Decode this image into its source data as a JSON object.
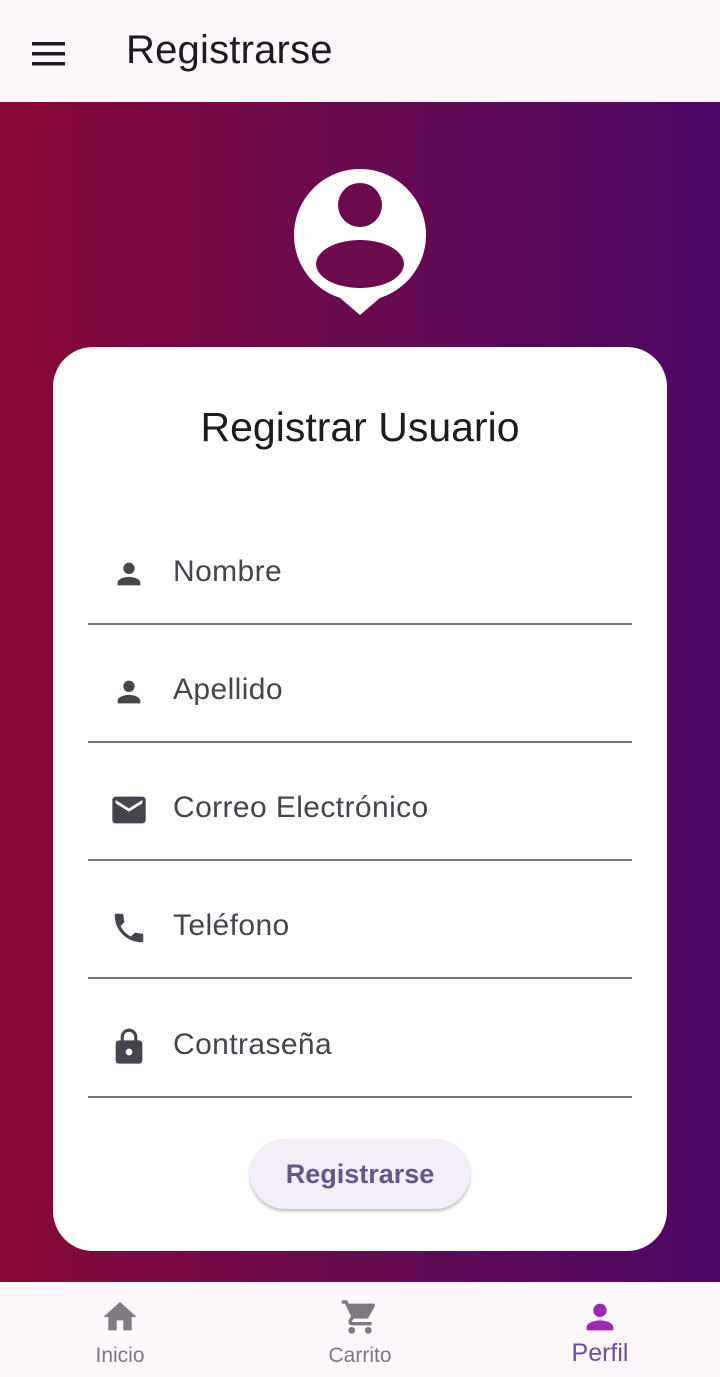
{
  "app_bar": {
    "title": "Registrarse",
    "menu_icon": "menu-icon"
  },
  "colors": {
    "gradient_start": "#8a0735",
    "gradient_end": "#4c0766",
    "accent": "#65558f",
    "active_nav": "#9c27b0"
  },
  "avatar": {
    "icon": "account-circle-icon"
  },
  "form": {
    "title": "Registrar Usuario",
    "fields": [
      {
        "icon": "person-icon",
        "placeholder": "Nombre"
      },
      {
        "icon": "person-icon",
        "placeholder": "Apellido"
      },
      {
        "icon": "email-icon",
        "placeholder": "Correo Electrónico"
      },
      {
        "icon": "phone-icon",
        "placeholder": "Teléfono"
      },
      {
        "icon": "lock-icon",
        "placeholder": "Contraseña"
      }
    ],
    "submit_label": "Registrarse"
  },
  "bottom_nav": {
    "items": [
      {
        "label": "Inicio",
        "icon": "home-icon",
        "active": false
      },
      {
        "label": "Carrito",
        "icon": "cart-icon",
        "active": false
      },
      {
        "label": "Perfil",
        "icon": "person-icon",
        "active": true
      }
    ]
  }
}
